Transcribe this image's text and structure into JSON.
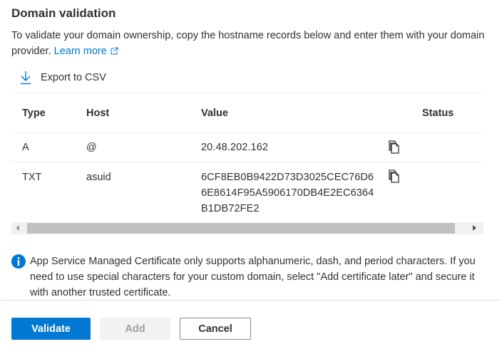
{
  "section": {
    "title": "Domain validation",
    "description": "To validate your domain ownership, copy the hostname records below and enter them with your domain provider.",
    "learn_more": "Learn more"
  },
  "toolbar": {
    "export_label": "Export to CSV"
  },
  "table": {
    "headers": {
      "type": "Type",
      "host": "Host",
      "value": "Value",
      "status": "Status"
    },
    "rows": [
      {
        "type": "A",
        "host": "@",
        "value_lines": [
          "20.48.202.162"
        ],
        "status": ""
      },
      {
        "type": "TXT",
        "host": "asuid",
        "value_lines": [
          "6CF8EB0B9422D73D3025CEC76D6",
          "6E8614F95A5906170DB4E2EC6364",
          "B1DB72FE2"
        ],
        "status": ""
      }
    ]
  },
  "info": {
    "text": "App Service Managed Certificate only supports alphanumeric, dash, and period characters. If you need to use special characters for your custom domain, select \"Add certificate later\" and secure it with another trusted certificate."
  },
  "footer": {
    "validate_label": "Validate",
    "add_label": "Add",
    "cancel_label": "Cancel"
  },
  "colors": {
    "accent": "#0078d4",
    "text": "#323130",
    "disabled_bg": "#f3f2f1",
    "disabled_text": "#a19f9d"
  }
}
